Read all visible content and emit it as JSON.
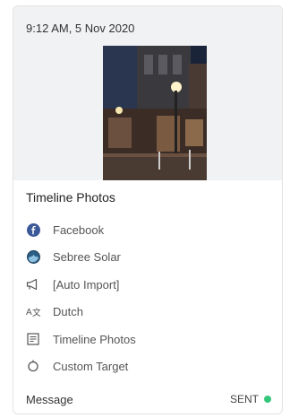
{
  "post": {
    "timestamp": "9:12 AM, 5 Nov 2020",
    "title": "Timeline Photos",
    "details": [
      {
        "icon": "facebook-icon",
        "label": "Facebook"
      },
      {
        "icon": "globe-avatar-icon",
        "label": "Sebree Solar"
      },
      {
        "icon": "megaphone-icon",
        "label": "[Auto Import]"
      },
      {
        "icon": "language-icon",
        "label": "Dutch"
      },
      {
        "icon": "album-icon",
        "label": "Timeline Photos"
      },
      {
        "icon": "target-icon",
        "label": "Custom Target"
      }
    ],
    "footer_label": "Message",
    "status": "SENT",
    "status_color": "#34c77b",
    "facebook_color": "#3b5998"
  }
}
